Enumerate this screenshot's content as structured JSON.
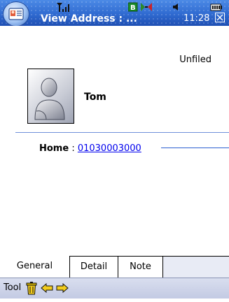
{
  "status_bar": {
    "title": "View Address : ...",
    "time": "11:28",
    "icons": [
      "signal-icon",
      "battery-bar-icon",
      "call-icon",
      "speaker-icon",
      "battery-icon",
      "close-icon"
    ]
  },
  "contact": {
    "category": "Unfiled",
    "name": "Tom",
    "phone_label": "Home",
    "phone_separator": " : ",
    "phone_number": "01030003000"
  },
  "tabs": [
    {
      "label": "General",
      "active": true
    },
    {
      "label": "Detail",
      "active": false
    },
    {
      "label": "Note",
      "active": false
    }
  ],
  "toolbar": {
    "menu_label": "Tool",
    "icons": [
      "trash-icon",
      "back-arrow-icon",
      "forward-arrow-icon"
    ]
  },
  "colors": {
    "title_bar": "#2f6ad0",
    "link": "#0000ee",
    "divider": "#6f8fd9",
    "toolbar": "#c9cfe6",
    "arrow_yellow": "#f2cc1d"
  }
}
